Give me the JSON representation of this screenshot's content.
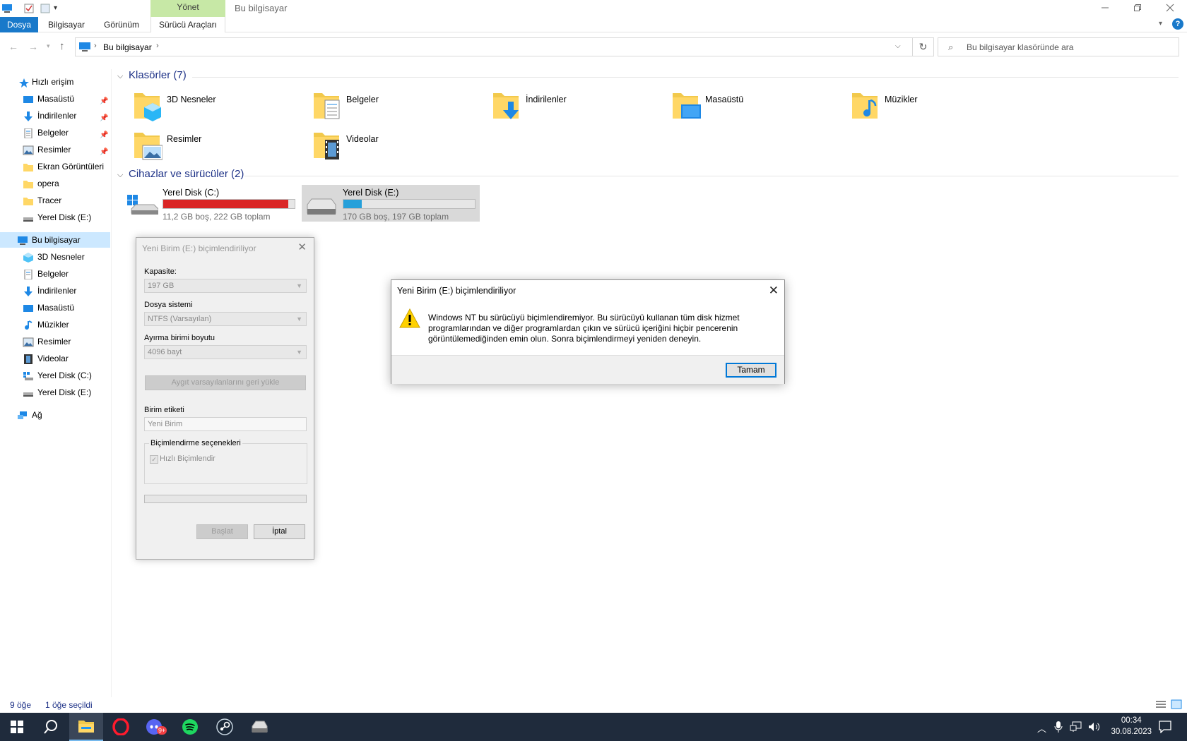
{
  "window": {
    "title": "Bu bilgisayar",
    "manage_tab": "Yönet"
  },
  "ribbon": {
    "tabs": [
      "Dosya",
      "Bilgisayar",
      "Görünüm",
      "Sürücü Araçları"
    ]
  },
  "address": {
    "path": "Bu bilgisayar",
    "search_placeholder": "Bu bilgisayar klasöründe ara"
  },
  "nav": {
    "quick_access": "Hızlı erişim",
    "quick_items": [
      "Masaüstü",
      "İndirilenler",
      "Belgeler",
      "Resimler",
      "Ekran Görüntüleri",
      "opera",
      "Tracer",
      "Yerel Disk (E:)"
    ],
    "this_pc": "Bu bilgisayar",
    "pc_items": [
      "3D Nesneler",
      "Belgeler",
      "İndirilenler",
      "Masaüstü",
      "Müzikler",
      "Resimler",
      "Videolar",
      "Yerel Disk (C:)",
      "Yerel Disk (E:)"
    ],
    "network": "Ağ"
  },
  "folders": {
    "header": "Klasörler (7)",
    "items": [
      "3D Nesneler",
      "Belgeler",
      "İndirilenler",
      "Masaüstü",
      "Müzikler",
      "Resimler",
      "Videolar"
    ]
  },
  "drives": {
    "header": "Cihazlar ve sürücüler (2)",
    "items": [
      {
        "name": "Yerel Disk (C:)",
        "info": "11,2 GB boş, 222 GB toplam",
        "used_fraction": 0.95,
        "color": "#da2626"
      },
      {
        "name": "Yerel Disk (E:)",
        "info": "170 GB boş, 197 GB toplam",
        "used_fraction": 0.14,
        "color": "#26a0da"
      }
    ]
  },
  "status": {
    "count": "9 öğe",
    "selected": "1 öğe seçildi"
  },
  "format_dialog": {
    "title": "Yeni Birim (E:) biçimlendiriliyor",
    "capacity_label": "Kapasite:",
    "capacity_value": "197 GB",
    "fs_label": "Dosya sistemi",
    "fs_value": "NTFS (Varsayılan)",
    "alloc_label": "Ayırma birimi boyutu",
    "alloc_value": "4096 bayt",
    "restore_btn": "Aygıt varsayılanlarını geri yükle",
    "volume_label": "Birim etiketi",
    "volume_value": "Yeni Birim",
    "options_label": "Biçimlendirme seçenekleri",
    "quick_format": "Hızlı Biçimlendir",
    "start_btn": "Başlat",
    "cancel_btn": "İptal"
  },
  "message_box": {
    "title": "Yeni Birim (E:) biçimlendiriliyor",
    "line1": "Windows NT bu sürücüyü biçimlendiremiyor.  Bu sürücüyü kullanan tüm disk hizmet",
    "line2": "programlarından ve diğer programlardan çıkın ve sürücü içeriğini hiçbir pencerenin",
    "line3": "görüntülemediğinden emin olun. Sonra biçimlendirmeyi yeniden deneyin.",
    "ok_btn": "Tamam"
  },
  "taskbar": {
    "time": "00:34",
    "date": "30.08.2023",
    "discord_badge": "9+"
  }
}
